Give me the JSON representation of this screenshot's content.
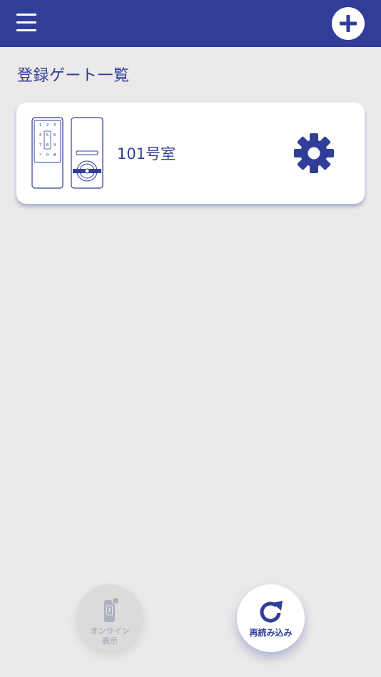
{
  "header": {
    "menu_icon": "hamburger-menu-icon",
    "add_icon": "plus-circle-icon"
  },
  "section_title": "登録ゲート一覧",
  "gates": [
    {
      "name": "101号室",
      "illustration": "smart-lock-keypad-icon",
      "settings_icon": "gear-icon",
      "keypad": [
        "1",
        "2",
        "3",
        "4",
        "5",
        "6",
        "7",
        "8",
        "9",
        "*",
        "0",
        "#"
      ]
    }
  ],
  "bottom_actions": {
    "online": {
      "label_line1": "オンライン",
      "label_line2": "表示",
      "icon": "phone-online-icon"
    },
    "reload": {
      "label": "再読み込み",
      "icon": "refresh-icon"
    }
  },
  "colors": {
    "primary": "#313e99",
    "background": "#ebe9ea",
    "card": "#ffffff",
    "disabled_button": "#dcdbdc"
  }
}
